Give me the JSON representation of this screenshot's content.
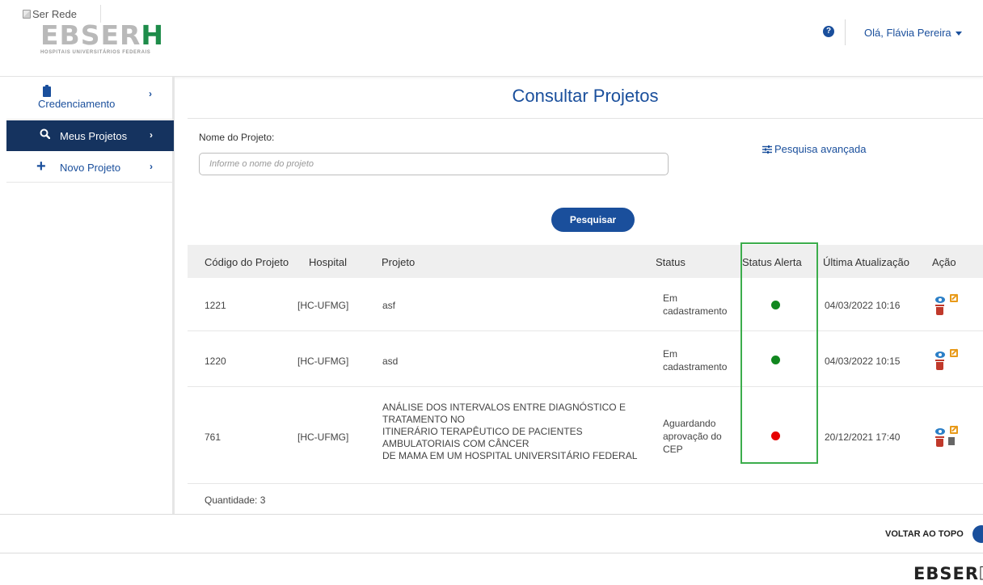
{
  "header": {
    "logo_alt": "Ser Rede",
    "logo_main": "EBSER",
    "logo_main_h": "H",
    "logo_sub": "HOSPITAIS UNIVERSITÁRIOS FEDERAIS",
    "user_greeting": "Olá, Flávia Pereira",
    "help_icon": "question-circle-icon"
  },
  "sidebar": {
    "items": [
      {
        "label": "Credenciamento",
        "icon": "clipboard-icon"
      },
      {
        "label": "Meus Projetos",
        "icon": "search-icon",
        "active": true
      },
      {
        "label": "Novo Projeto",
        "icon": "plus-icon"
      }
    ]
  },
  "main": {
    "title": "Consultar Projetos",
    "name_label": "Nome do Projeto:",
    "name_placeholder": "Informe o nome do projeto",
    "advanced_search": "Pesquisa avançada",
    "search_button": "Pesquisar"
  },
  "table": {
    "headers": [
      "Código do Projeto",
      "Hospital",
      "Projeto",
      "Status",
      "Status Alerta",
      "Última Atualização",
      "Ação"
    ],
    "rows": [
      {
        "code": "1221",
        "hospital": "[HC-UFMG]",
        "project": [
          "asf"
        ],
        "status": [
          "Em",
          "cadastramento"
        ],
        "alert": "green",
        "updated": "04/03/2022 10:16"
      },
      {
        "code": "1220",
        "hospital": "[HC-UFMG]",
        "project": [
          "asd"
        ],
        "status": [
          "Em",
          "cadastramento"
        ],
        "alert": "green",
        "updated": "04/03/2022 10:15"
      },
      {
        "code": "761",
        "hospital": "[HC-UFMG]",
        "project": [
          "ANÁLISE DOS INTERVALOS ENTRE DIAGNÓSTICO E",
          "TRATAMENTO NO",
          "ITINERÁRIO TERAPÊUTICO DE PACIENTES",
          "AMBULATORIAIS COM CÂNCER",
          "DE MAMA EM UM HOSPITAL UNIVERSITÁRIO FEDERAL"
        ],
        "status": [
          "Aguardando",
          "aprovação do",
          "CEP"
        ],
        "alert": "red",
        "updated": "20/12/2021 17:40"
      }
    ],
    "quantity": "Quantidade: 3"
  },
  "footer": {
    "back_to_top": "VOLTAR AO TOPO",
    "logo_main": "EBSER",
    "logo_main_h": "H"
  },
  "colors": {
    "primary": "#1a4f9c",
    "sidebar_active": "#15335f",
    "alert_green": "#11871f",
    "alert_red": "#e60000",
    "highlight_box": "#3cad4c"
  }
}
